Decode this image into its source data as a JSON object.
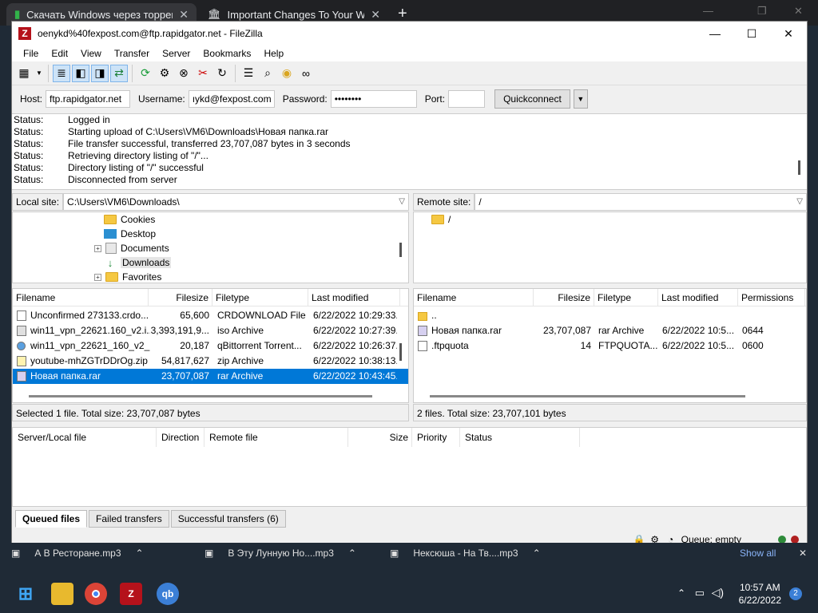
{
  "browser": {
    "tab1_title": "Скачать Windows через торрен",
    "tab2_title": "Important Changes To Your Well"
  },
  "window": {
    "title": "oenykd%40fexpost.com@ftp.rapidgator.net - FileZilla"
  },
  "menu": [
    "File",
    "Edit",
    "View",
    "Transfer",
    "Server",
    "Bookmarks",
    "Help"
  ],
  "quickconnect": {
    "host_label": "Host:",
    "host": "ftp.rapidgator.net",
    "user_label": "Username:",
    "username": "ıykd@fexpost.com",
    "pass_label": "Password:",
    "password": "••••••••",
    "port_label": "Port:",
    "port": "",
    "button": "Quickconnect"
  },
  "log": [
    {
      "k": "Status:",
      "v": "Logged in"
    },
    {
      "k": "Status:",
      "v": "Starting upload of C:\\Users\\VM6\\Downloads\\Новая папка.rar"
    },
    {
      "k": "Status:",
      "v": "File transfer successful, transferred 23,707,087 bytes in 3 seconds"
    },
    {
      "k": "Status:",
      "v": "Retrieving directory listing of \"/\"..."
    },
    {
      "k": "Status:",
      "v": "Directory listing of \"/\" successful"
    },
    {
      "k": "Status:",
      "v": "Disconnected from server"
    }
  ],
  "local": {
    "label": "Local site:",
    "path": "C:\\Users\\VM6\\Downloads\\",
    "tree": [
      "Cookies",
      "Desktop",
      "Documents",
      "Downloads",
      "Favorites"
    ],
    "headers": [
      "Filename",
      "Filesize",
      "Filetype",
      "Last modified"
    ],
    "files": [
      {
        "name": "Unconfirmed 273133.crdo...",
        "size": "65,600",
        "type": "CRDOWNLOAD File",
        "mod": "6/22/2022 10:29:33..."
      },
      {
        "name": "win11_vpn_22621.160_v2.i...",
        "size": "3,393,191,9...",
        "type": "iso Archive",
        "mod": "6/22/2022 10:27:39..."
      },
      {
        "name": "win11_vpn_22621_160_v2_...",
        "size": "20,187",
        "type": "qBittorrent Torrent...",
        "mod": "6/22/2022 10:26:37..."
      },
      {
        "name": "youtube-mhZGTrDDrOg.zip",
        "size": "54,817,627",
        "type": "zip Archive",
        "mod": "6/22/2022 10:38:13..."
      },
      {
        "name": "Новая папка.rar",
        "size": "23,707,087",
        "type": "rar Archive",
        "mod": "6/22/2022 10:43:45..."
      }
    ],
    "status": "Selected 1 file. Total size: 23,707,087 bytes"
  },
  "remote": {
    "label": "Remote site:",
    "path": "/",
    "tree": [
      "/"
    ],
    "headers": [
      "Filename",
      "Filesize",
      "Filetype",
      "Last modified",
      "Permissions"
    ],
    "files": [
      {
        "name": "..",
        "size": "",
        "type": "",
        "mod": "",
        "perm": ""
      },
      {
        "name": "Новая папка.rar",
        "size": "23,707,087",
        "type": "rar Archive",
        "mod": "6/22/2022 10:5...",
        "perm": "0644"
      },
      {
        "name": ".ftpquota",
        "size": "14",
        "type": "FTPQUOTA...",
        "mod": "6/22/2022 10:5...",
        "perm": "0600"
      }
    ],
    "status": "2 files. Total size: 23,707,101 bytes"
  },
  "queue": {
    "headers": [
      "Server/Local file",
      "Direction",
      "Remote file",
      "Size",
      "Priority",
      "Status"
    ],
    "tabs": [
      "Queued files",
      "Failed transfers",
      "Successful transfers (6)"
    ],
    "status": "Queue: empty"
  },
  "media": [
    "А В Ресторане.mp3",
    "В Эту Лунную Но....mp3",
    "Нексюша - На Тв....mp3"
  ],
  "media_show_all": "Show all",
  "taskbar": {
    "time": "10:57 AM",
    "date": "6/22/2022",
    "notifications": "2"
  }
}
